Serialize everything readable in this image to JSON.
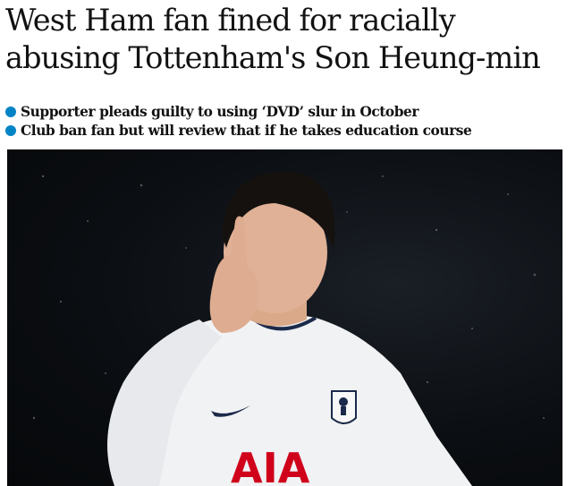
{
  "article": {
    "headline": "West Ham fan fined for racially abusing Tottenham's Son Heung-min",
    "bullets": [
      "Supporter pleads guilty to using ‘DVD’ slur in October",
      "Club ban fan but will review that if he takes education course"
    ],
    "bullet_color": "#0084c6",
    "image": {
      "description_icon": "photo-footballer-shush",
      "shirt_sponsor": "AIA"
    }
  }
}
